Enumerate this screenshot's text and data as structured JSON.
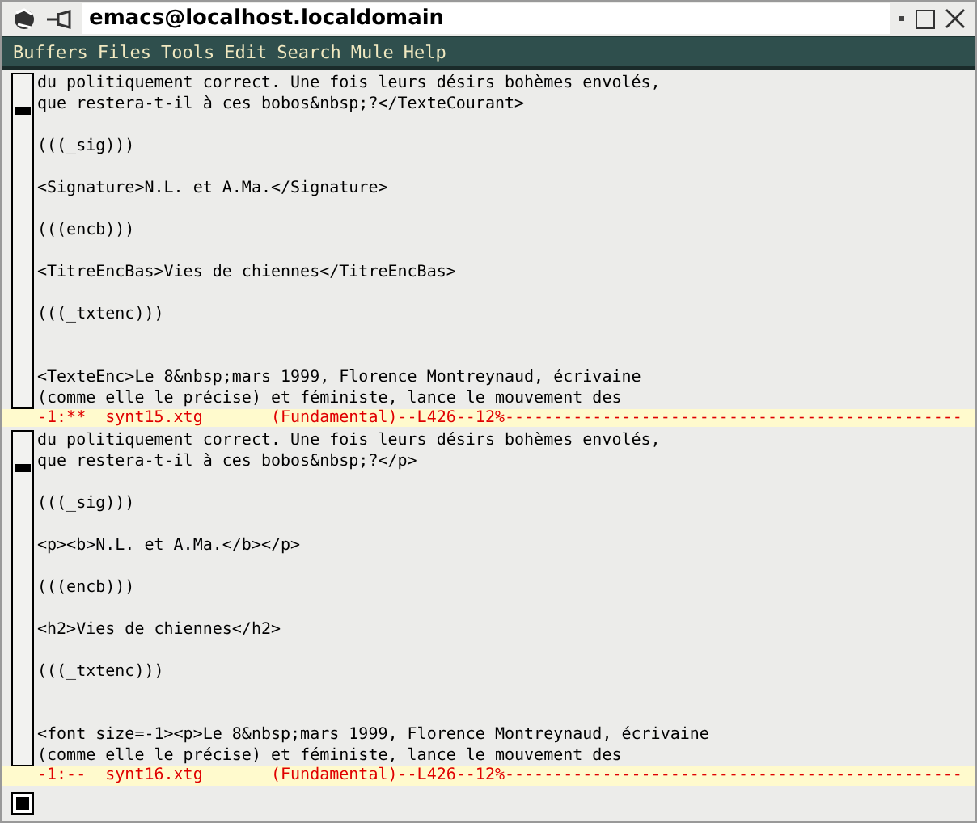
{
  "window": {
    "title": "emacs@localhost.localdomain"
  },
  "menu": [
    "Buffers",
    "Files",
    "Tools",
    "Edit",
    "Search",
    "Mule",
    "Help"
  ],
  "panes": [
    {
      "lines": [
        {
          "kind": "text",
          "text": "du politiquement correct. Une fois leurs désirs bohèmes envolés,"
        },
        {
          "kind": "text",
          "text": "que restera-t-il à ces bobos&nbsp;?</TexteCourant>"
        },
        {
          "kind": "blank"
        },
        {
          "kind": "text",
          "text": "(((_sig)))"
        },
        {
          "kind": "blank"
        },
        {
          "kind": "text",
          "text": "<Signature>N.L. et A.Ma.</Signature>"
        },
        {
          "kind": "blank"
        },
        {
          "kind": "text",
          "text": "(((encb)))"
        },
        {
          "kind": "blank"
        },
        {
          "kind": "text",
          "text": "<TitreEncBas>Vies de chiennes</TitreEncBas>"
        },
        {
          "kind": "blank"
        },
        {
          "kind": "text",
          "text": "(((_txtenc)))"
        },
        {
          "kind": "blank"
        },
        {
          "kind": "blank"
        },
        {
          "kind": "text",
          "text": "<TexteEnc>Le 8&nbsp;mars 1999, Florence Montreynaud, écrivaine"
        },
        {
          "kind": "text",
          "text": "(comme elle le précise) et féministe, lance le mouvement des"
        }
      ],
      "modeline": "-1:**  synt15.xtg       (Fundamental)--L426--12%-----------------------------------------------"
    },
    {
      "lines": [
        {
          "kind": "text",
          "text": "du politiquement correct. Une fois leurs désirs bohèmes envolés,"
        },
        {
          "kind": "text",
          "text": "que restera-t-il à ces bobos&nbsp;?</p>"
        },
        {
          "kind": "blank"
        },
        {
          "kind": "text",
          "text": "(((_sig)))"
        },
        {
          "kind": "blank"
        },
        {
          "kind": "text",
          "text": "<p><b>N.L. et A.Ma.</b></p>"
        },
        {
          "kind": "blank"
        },
        {
          "kind": "text",
          "text": "(((encb)))"
        },
        {
          "kind": "blank"
        },
        {
          "kind": "text",
          "text": "<h2>Vies de chiennes</h2>"
        },
        {
          "kind": "blank"
        },
        {
          "kind": "text",
          "text": "(((_txtenc)))"
        },
        {
          "kind": "blank"
        },
        {
          "kind": "blank"
        },
        {
          "kind": "text",
          "text": "<font size=-1><p>Le 8&nbsp;mars 1999, Florence Montreynaud, écrivaine"
        },
        {
          "kind": "text",
          "text": "(comme elle le précise) et féministe, lance le mouvement des"
        }
      ],
      "modeline": "-1:--  synt16.xtg       (Fundamental)--L426--12%-----------------------------------------------"
    }
  ]
}
